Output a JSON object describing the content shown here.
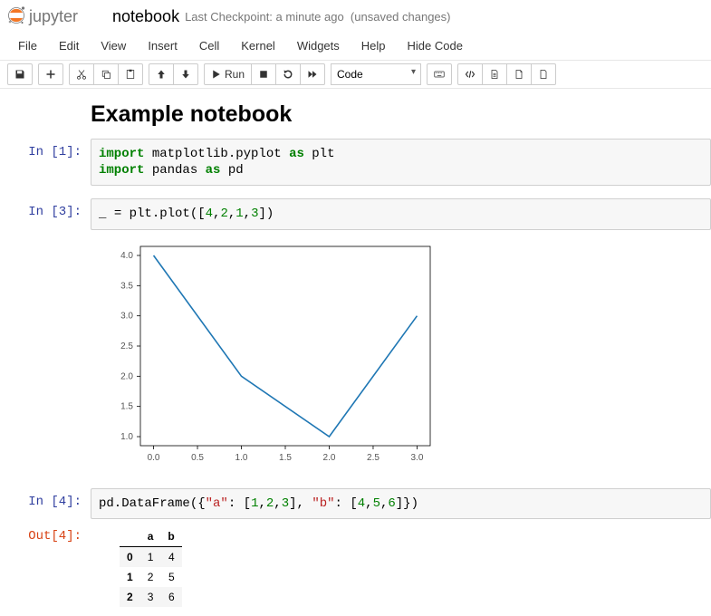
{
  "header": {
    "title": "notebook",
    "checkpoint": "Last Checkpoint: a minute ago",
    "autosave": "(unsaved changes)"
  },
  "menubar": [
    "File",
    "Edit",
    "View",
    "Insert",
    "Cell",
    "Kernel",
    "Widgets",
    "Help",
    "Hide Code"
  ],
  "toolbar": {
    "run_label": "Run",
    "celltype": "Code"
  },
  "notebook_heading": "Example notebook",
  "cells": {
    "c1": {
      "prompt": "In [1]:"
    },
    "c2": {
      "prompt": "In [3]:"
    },
    "c3": {
      "prompt": "In [4]:",
      "out_prompt": "Out[4]:"
    }
  },
  "code": {
    "c1_import": "import",
    "c1_mpl": " matplotlib.pyplot ",
    "c1_as": "as",
    "c1_plt": " plt",
    "c1_pd_mod": " pandas ",
    "c1_pd": " pd",
    "c2_lhs": "_ ",
    "c2_eq": "=",
    "c2_call1": " plt.plot([",
    "c2_n1": "4",
    "c2_c1": ",",
    "c2_n2": "2",
    "c2_c2": ",",
    "c2_n3": "1",
    "c2_c3": ",",
    "c2_n4": "3",
    "c2_call2": "])",
    "c3_a": "pd.DataFrame({",
    "c3_ka": "\"a\"",
    "c3_b": ": [",
    "c3_n1": "1",
    "c3_c1": ",",
    "c3_n2": "2",
    "c3_c2": ",",
    "c3_n3": "3",
    "c3_c": "], ",
    "c3_kb": "\"b\"",
    "c3_d": ": [",
    "c3_n4": "4",
    "c3_c3": ",",
    "c3_n5": "5",
    "c3_c4": ",",
    "c3_n6": "6",
    "c3_e": "]})"
  },
  "chart_data": {
    "type": "line",
    "x": [
      0,
      1,
      2,
      3
    ],
    "values": [
      4,
      2,
      1,
      3
    ],
    "xticks": [
      "0.0",
      "0.5",
      "1.0",
      "1.5",
      "2.0",
      "2.5",
      "3.0"
    ],
    "yticks": [
      "1.0",
      "1.5",
      "2.0",
      "2.5",
      "3.0",
      "3.5",
      "4.0"
    ],
    "xlim": [
      -0.15,
      3.15
    ],
    "ylim": [
      0.85,
      4.15
    ]
  },
  "dataframe": {
    "columns": [
      "a",
      "b"
    ],
    "index": [
      "0",
      "1",
      "2"
    ],
    "rows": [
      [
        "1",
        "4"
      ],
      [
        "2",
        "5"
      ],
      [
        "3",
        "6"
      ]
    ]
  }
}
